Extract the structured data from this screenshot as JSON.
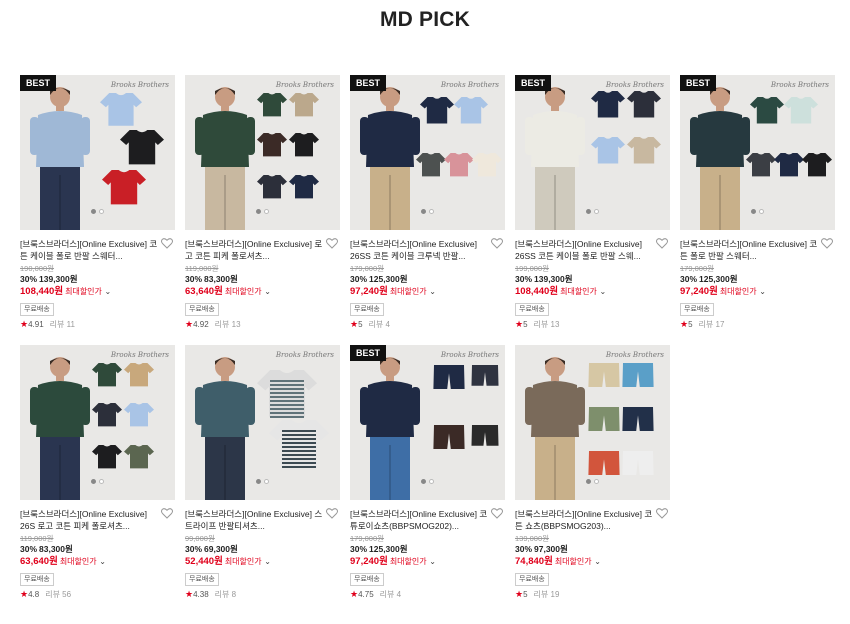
{
  "section_title": "MD PICK",
  "brand_signature": "Brooks Brothers",
  "free_shipping_label": "무료배송",
  "review_label": "리뷰",
  "max_discount_label": "최대할인가",
  "currency": "원",
  "colors": {
    "accent": "#e0001b",
    "best_badge": "#111111"
  },
  "products": [
    {
      "best": true,
      "name": "[브룩스브라더스][Online Exclusive] 코튼 케이블 폴로 반팔 스웨터...",
      "original_price": "190,000원",
      "discount_pct": "30%",
      "discount_price": "139,300원",
      "max_price": "108,440",
      "rating": "4.91",
      "reviews": "11"
    },
    {
      "best": false,
      "name": "[브룩스브라더스][Online Exclusive] 로고 코튼 피케 폴로셔츠...",
      "original_price": "119,000원",
      "discount_pct": "30%",
      "discount_price": "83,300원",
      "max_price": "63,640",
      "rating": "4.92",
      "reviews": "13"
    },
    {
      "best": true,
      "name": "[브룩스브라더스][Online Exclusive] 26SS 코튼 케이블 크루넥 반팔...",
      "original_price": "179,000원",
      "discount_pct": "30%",
      "discount_price": "125,300원",
      "max_price": "97,240",
      "rating": "5",
      "reviews": "4"
    },
    {
      "best": true,
      "name": "[브룩스브라더스][Online Exclusive] 26SS 코튼 케이블 폴로 반팔 스웨...",
      "original_price": "199,000원",
      "discount_pct": "30%",
      "discount_price": "139,300원",
      "max_price": "108,440",
      "rating": "5",
      "reviews": "13"
    },
    {
      "best": true,
      "name": "[브룩스브라더스][Online Exclusive] 코튼 폴로 반팔 스웨터...",
      "original_price": "179,000원",
      "discount_pct": "30%",
      "discount_price": "125,300원",
      "max_price": "97,240",
      "rating": "5",
      "reviews": "17"
    },
    {
      "best": false,
      "name": "[브룩스브라더스][Online Exclusive] 26S 로고 코튼 피케 폴로셔츠...",
      "original_price": "119,000원",
      "discount_pct": "30%",
      "discount_price": "83,300원",
      "max_price": "63,640",
      "rating": "4.8",
      "reviews": "56"
    },
    {
      "best": false,
      "name": "[브룩스브라더스][Online Exclusive] 스트라이프 반팔티셔츠...",
      "original_price": "99,000원",
      "discount_pct": "30%",
      "discount_price": "69,300원",
      "max_price": "52,440",
      "rating": "4.38",
      "reviews": "8"
    },
    {
      "best": true,
      "name": "[브룩스브라더스][Online Exclusive] 코튜로이쇼츠(BBPSMOG202)...",
      "original_price": "179,000원",
      "discount_pct": "30%",
      "discount_price": "125,300원",
      "max_price": "97,240",
      "rating": "4.75",
      "reviews": "4"
    },
    {
      "best": false,
      "name": "[브룩스브라더스][Online Exclusive] 코튼 쇼츠(BBPSMOG203)...",
      "original_price": "139,000원",
      "discount_pct": "30%",
      "discount_price": "97,300원",
      "max_price": "74,840",
      "rating": "5",
      "reviews": "19"
    }
  ]
}
